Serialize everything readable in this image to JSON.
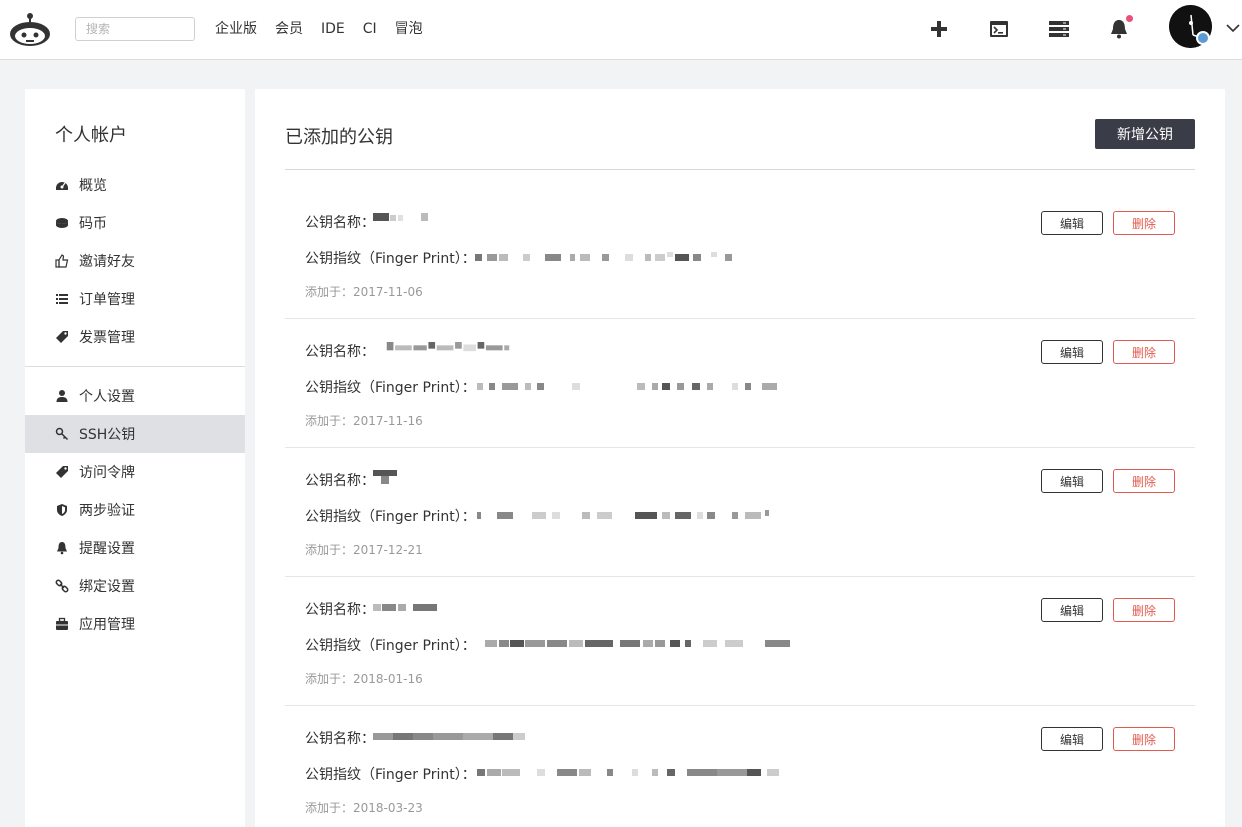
{
  "topbar": {
    "search_placeholder": "搜索",
    "nav": [
      "企业版",
      "会员",
      "IDE",
      "CI",
      "冒泡"
    ],
    "icons": [
      "plus-icon",
      "terminal-icon",
      "server-icon",
      "bell-icon"
    ],
    "notification_dot_color": "#e8527a"
  },
  "sidebar": {
    "title": "个人帐户",
    "group1": [
      {
        "label": "概览",
        "icon": "dashboard-icon"
      },
      {
        "label": "码币",
        "icon": "coin-icon"
      },
      {
        "label": "邀请好友",
        "icon": "thumbs-up-icon"
      },
      {
        "label": "订单管理",
        "icon": "list-icon"
      },
      {
        "label": "发票管理",
        "icon": "tag-icon"
      }
    ],
    "group2": [
      {
        "label": "个人设置",
        "icon": "user-icon"
      },
      {
        "label": "SSH公钥",
        "icon": "key-icon",
        "active": true
      },
      {
        "label": "访问令牌",
        "icon": "ticket-icon"
      },
      {
        "label": "两步验证",
        "icon": "shield-icon"
      },
      {
        "label": "提醒设置",
        "icon": "bell-icon"
      },
      {
        "label": "绑定设置",
        "icon": "link-icon"
      },
      {
        "label": "应用管理",
        "icon": "briefcase-icon"
      }
    ]
  },
  "main": {
    "title": "已添加的公钥",
    "add_button": "新增公钥",
    "name_label": "公钥名称：",
    "fingerprint_label": "公钥指纹（Finger Print）：",
    "edit_label": "编辑",
    "delete_label": "删除",
    "keys": [
      {
        "added": "添加于：2017-11-06"
      },
      {
        "added": "添加于：2017-11-16"
      },
      {
        "added": "添加于：2017-12-21"
      },
      {
        "added": "添加于：2018-01-16"
      },
      {
        "added": "添加于：2018-03-23"
      }
    ]
  },
  "colors": {
    "primary_button": "#3a3d47",
    "danger": "#e05a4f",
    "active_nav": "#dfe0e4"
  }
}
